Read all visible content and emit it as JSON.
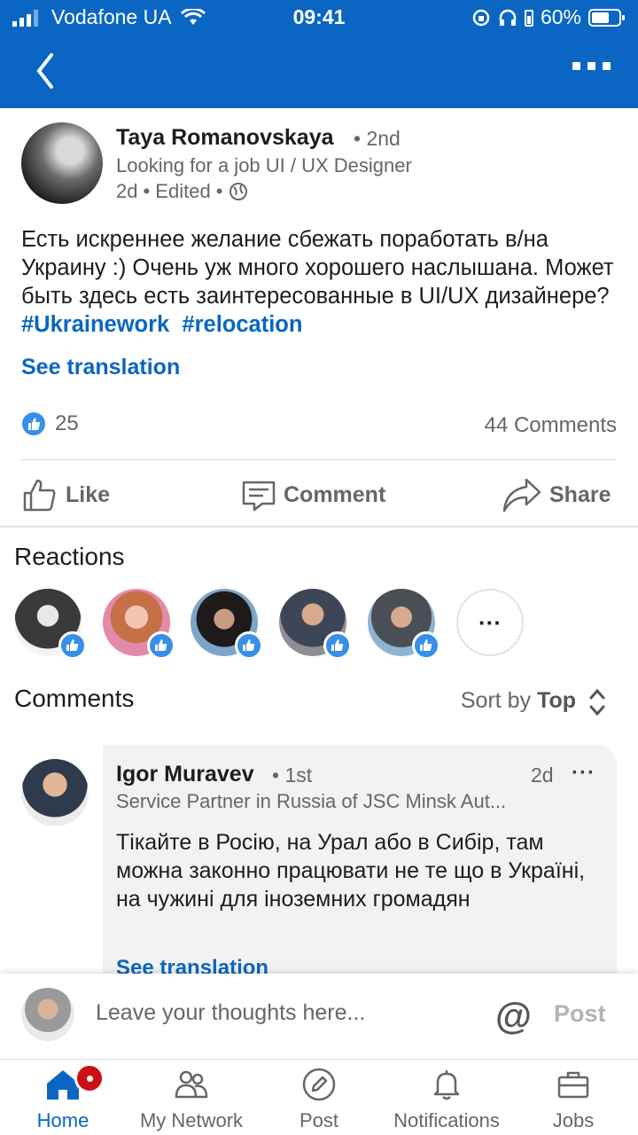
{
  "status_bar": {
    "carrier": "Vodafone UA",
    "time": "09:41",
    "battery": "60%"
  },
  "header": {
    "back_icon": "chevron-left-icon",
    "more_icon": "more-horizontal-icon"
  },
  "post": {
    "author_name": "Taya Romanovskaya",
    "author_degree": "• 2nd",
    "author_headline": "Looking for a job UI / UX Designer",
    "meta_time": "2d",
    "meta_edited": "• Edited •",
    "text": "Есть искреннее желание сбежать поработать в/на Украину :) Очень уж много хорошего наслышана. Может быть здесь есть заинтересованные в UI/UX дизайнере?",
    "hashtags": [
      "#Ukrainework",
      "#relocation"
    ],
    "see_translation": "See translation",
    "like_count": "25",
    "comments_count": "44 Comments"
  },
  "actions": {
    "like": "Like",
    "comment": "Comment",
    "share": "Share"
  },
  "reactions": {
    "title": "Reactions",
    "more": "···"
  },
  "comments": {
    "title": "Comments",
    "sort_prefix": "Sort by",
    "sort_value": "Top",
    "items": [
      {
        "name": "Igor Muravev",
        "degree": "• 1st",
        "time": "2d",
        "more": "···",
        "headline": "Service Partner in Russia of JSC Minsk Aut...",
        "text": "Тікайте в Росію, на Урал або в Сибір, там можна законно працювати не те що в Україні, на чужині для іноземних громадян",
        "see_translation": "See translation"
      }
    ]
  },
  "compose": {
    "placeholder": "Leave your thoughts here...",
    "at": "@",
    "post": "Post"
  },
  "bottom_nav": {
    "items": [
      {
        "label": "Home",
        "icon": "home-icon"
      },
      {
        "label": "My Network",
        "icon": "network-icon"
      },
      {
        "label": "Post",
        "icon": "compose-icon"
      },
      {
        "label": "Notifications",
        "icon": "bell-icon"
      },
      {
        "label": "Jobs",
        "icon": "briefcase-icon"
      }
    ]
  },
  "colors": {
    "brand": "#0a66c2",
    "reaction_like": "#378fe9",
    "badge_red": "#cc1016"
  }
}
